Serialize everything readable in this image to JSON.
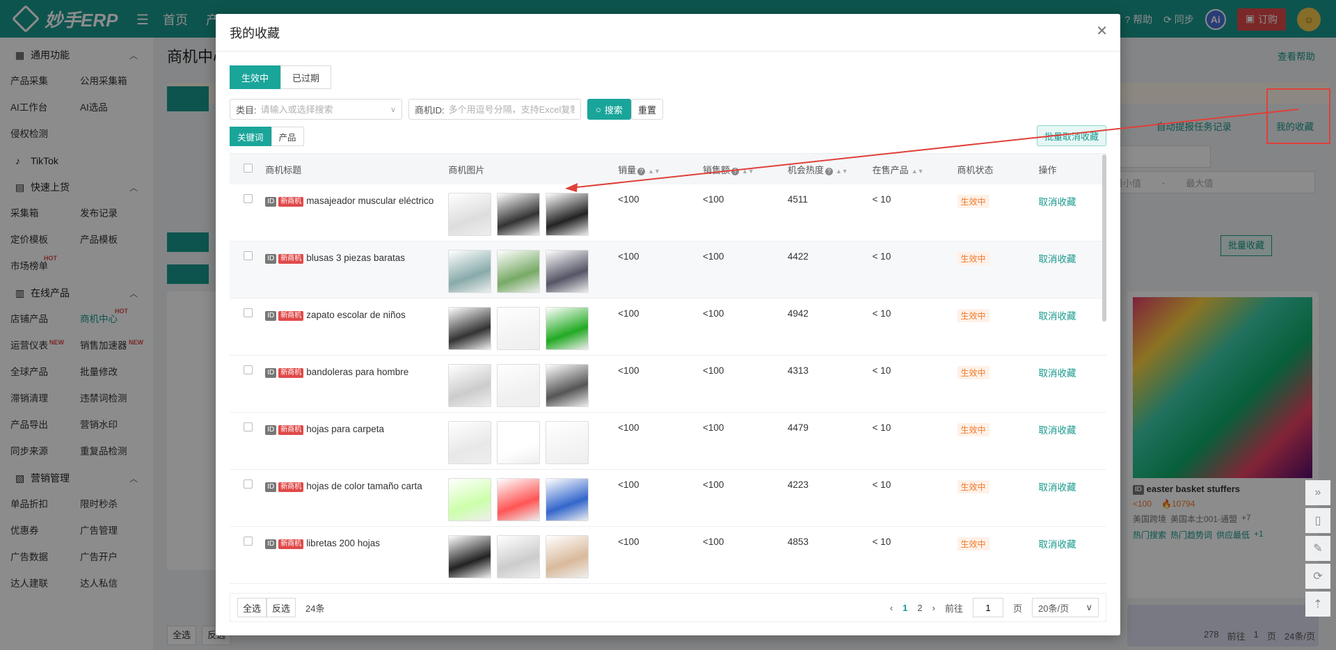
{
  "app": {
    "logo_text": "妙手ERP",
    "nav": [
      "首页",
      "产"
    ],
    "help": "帮助",
    "sync": "同步",
    "ai": "Ai",
    "order": "订购"
  },
  "sidebar": {
    "general": {
      "title": "通用功能",
      "items": [
        "产品采集",
        "公用采集箱",
        "AI工作台",
        "AI选品",
        "侵权检测"
      ]
    },
    "tiktok": "TikTok",
    "quick": {
      "title": "快速上货",
      "items": [
        "采集箱",
        "发布记录",
        "定价模板",
        "产品模板",
        "市场榜单"
      ]
    },
    "online": {
      "title": "在线产品",
      "items": [
        "店铺产品",
        "商机中心",
        "运营仪表",
        "销售加速器",
        "全球产品",
        "批量修改",
        "滞销清理",
        "违禁词检测",
        "产品导出",
        "营销水印",
        "同步来源",
        "重复品检测"
      ]
    },
    "marketing": {
      "title": "营销管理",
      "items": [
        "单品折扣",
        "限时秒杀",
        "优惠券",
        "广告管理",
        "广告数据",
        "广告开户",
        "达人建联",
        "达人私信"
      ]
    },
    "tags": {
      "hot": "HOT",
      "new": "NEW"
    }
  },
  "background": {
    "page_title": "商机中心",
    "help_link": "查看帮助",
    "auto_record": "自动提报任务记录",
    "my_fav": "我的收藏",
    "batch_fav": "批量收藏",
    "min": "最小值",
    "max": "最大值",
    "card_title": "easter basket stuffers",
    "card_sales": "<100",
    "card_heat": "10794",
    "card_tags": [
      "美国跨境",
      "美国本土001-通盟",
      "+7"
    ],
    "card_tags2": [
      "热门搜索",
      "热门趋势词",
      "供应最低",
      "+1"
    ],
    "bottom": {
      "select_all": "全选",
      "invert": "反选",
      "count": "278",
      "goto": "前往",
      "page": "1",
      "page_unit": "页",
      "per_page": "24条/页"
    }
  },
  "modal": {
    "title": "我的收藏",
    "tabs": [
      "生效中",
      "已过期"
    ],
    "category_label": "类目:",
    "category_placeholder": "请输入或选择搜索",
    "id_label": "商机ID:",
    "id_placeholder": "多个用逗号分隔，支持Excel复制粘贴",
    "search": "搜索",
    "reset": "重置",
    "type_tabs": [
      "关键词",
      "产品"
    ],
    "batch_cancel": "批量取消收藏",
    "columns": [
      "商机标题",
      "商机图片",
      "销量",
      "销售额",
      "机会热度",
      "在售产品",
      "商机状态",
      "操作"
    ],
    "id_badge": "ID",
    "new_badge": "新商机",
    "rows": [
      {
        "title": "masajeador muscular eléctrico",
        "sales": "<100",
        "revenue": "<100",
        "heat": "4511",
        "on_sale": "< 10",
        "status": "生效中",
        "op": "取消收藏"
      },
      {
        "title": "blusas 3 piezas baratas",
        "sales": "<100",
        "revenue": "<100",
        "heat": "4422",
        "on_sale": "< 10",
        "status": "生效中",
        "op": "取消收藏"
      },
      {
        "title": "zapato escolar de niños",
        "sales": "<100",
        "revenue": "<100",
        "heat": "4942",
        "on_sale": "< 10",
        "status": "生效中",
        "op": "取消收藏"
      },
      {
        "title": "bandoleras para hombre",
        "sales": "<100",
        "revenue": "<100",
        "heat": "4313",
        "on_sale": "< 10",
        "status": "生效中",
        "op": "取消收藏"
      },
      {
        "title": "hojas para carpeta",
        "sales": "<100",
        "revenue": "<100",
        "heat": "4479",
        "on_sale": "< 10",
        "status": "生效中",
        "op": "取消收藏"
      },
      {
        "title": "hojas de color tamaño carta",
        "sales": "<100",
        "revenue": "<100",
        "heat": "4223",
        "on_sale": "< 10",
        "status": "生效中",
        "op": "取消收藏"
      },
      {
        "title": "libretas 200 hojas",
        "sales": "<100",
        "revenue": "<100",
        "heat": "4853",
        "on_sale": "< 10",
        "status": "生效中",
        "op": "取消收藏"
      }
    ],
    "pager": {
      "select_all": "全选",
      "invert": "反选",
      "total": "24条",
      "pages": [
        "1",
        "2"
      ],
      "goto": "前往",
      "page_value": "1",
      "page_unit": "页",
      "per_page": "20条/页"
    }
  },
  "colors": {
    "primary": "#1aa59a",
    "topbar": "#1a9a8e",
    "danger": "#e04a4a",
    "status": "#f07a2a"
  }
}
